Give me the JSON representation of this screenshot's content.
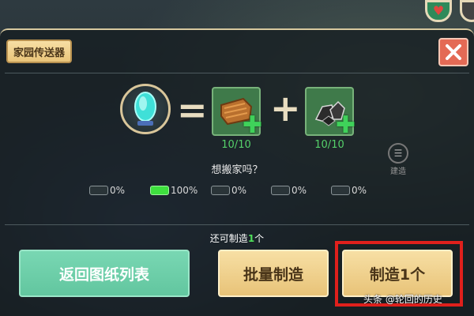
{
  "hud": {
    "heart_icon": "heart-icon"
  },
  "panel": {
    "title": "家园传送器",
    "close_icon": "close-icon"
  },
  "recipe": {
    "result_icon": "teleporter-crystal-icon",
    "equals": "=",
    "plus": "+",
    "materials": [
      {
        "icon": "leather-material-icon",
        "count": "10/10"
      },
      {
        "icon": "ore-material-icon",
        "count": "10/10"
      }
    ]
  },
  "side_icon": {
    "label": "建造"
  },
  "question": "想搬家吗？",
  "chances": [
    {
      "pct": "0%",
      "active": false
    },
    {
      "pct": "100%",
      "active": true
    },
    {
      "pct": "0%",
      "active": false
    },
    {
      "pct": "0%",
      "active": false
    },
    {
      "pct": "0%",
      "active": false
    }
  ],
  "remaining": {
    "prefix": "还可制造",
    "number": "1",
    "suffix": "个"
  },
  "buttons": {
    "back": "返回图纸列表",
    "batch": "批量制造",
    "make_one": "制造1个"
  },
  "watermark": "头条 @轮回的历史",
  "colors": {
    "accent_green": "#4fe05a",
    "highlight_red": "#e0201c"
  }
}
